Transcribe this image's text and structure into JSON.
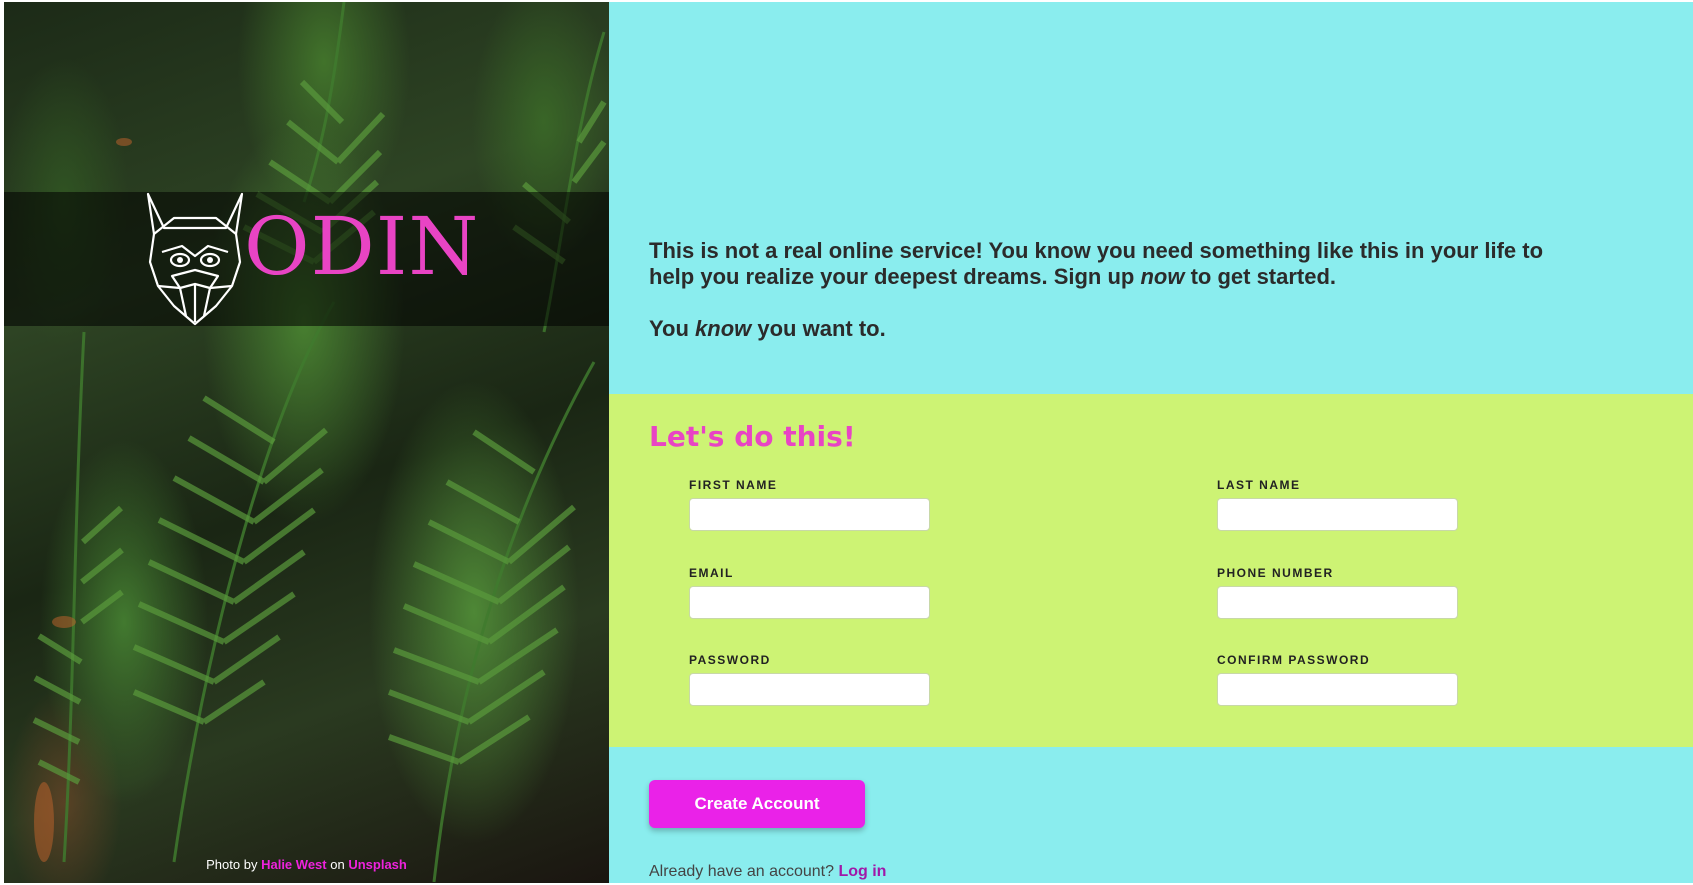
{
  "brand": {
    "logo_text": "ODIN",
    "logo_color": "#e844c4"
  },
  "photo_credit": {
    "prefix": "Photo by",
    "author": "Halie West",
    "middle": "on",
    "source": "Unsplash",
    "link_color": "#ee22dd"
  },
  "intro": {
    "line1_before": "This is not a real online service! You know you need something like this in your life to help you realize your deepest dreams. Sign up ",
    "line1_em": "now",
    "line1_after": " to get started.",
    "line2_before": "You ",
    "line2_em": "know",
    "line2_after": " you want to.",
    "background": "#8aedee"
  },
  "form": {
    "heading": "Let's do this!",
    "background": "#cdf374",
    "fields": {
      "first_name": {
        "label": "FIRST NAME",
        "value": ""
      },
      "last_name": {
        "label": "LAST NAME",
        "value": ""
      },
      "email": {
        "label": "EMAIL",
        "value": ""
      },
      "phone": {
        "label": "PHONE NUMBER",
        "value": ""
      },
      "password": {
        "label": "PASSWORD",
        "value": ""
      },
      "confirm_password": {
        "label": "CONFIRM PASSWORD",
        "value": ""
      }
    }
  },
  "actions": {
    "create_label": "Create Account",
    "button_color": "#ea22e8",
    "login_prompt": "Already have an account?",
    "login_link": "Log in"
  }
}
